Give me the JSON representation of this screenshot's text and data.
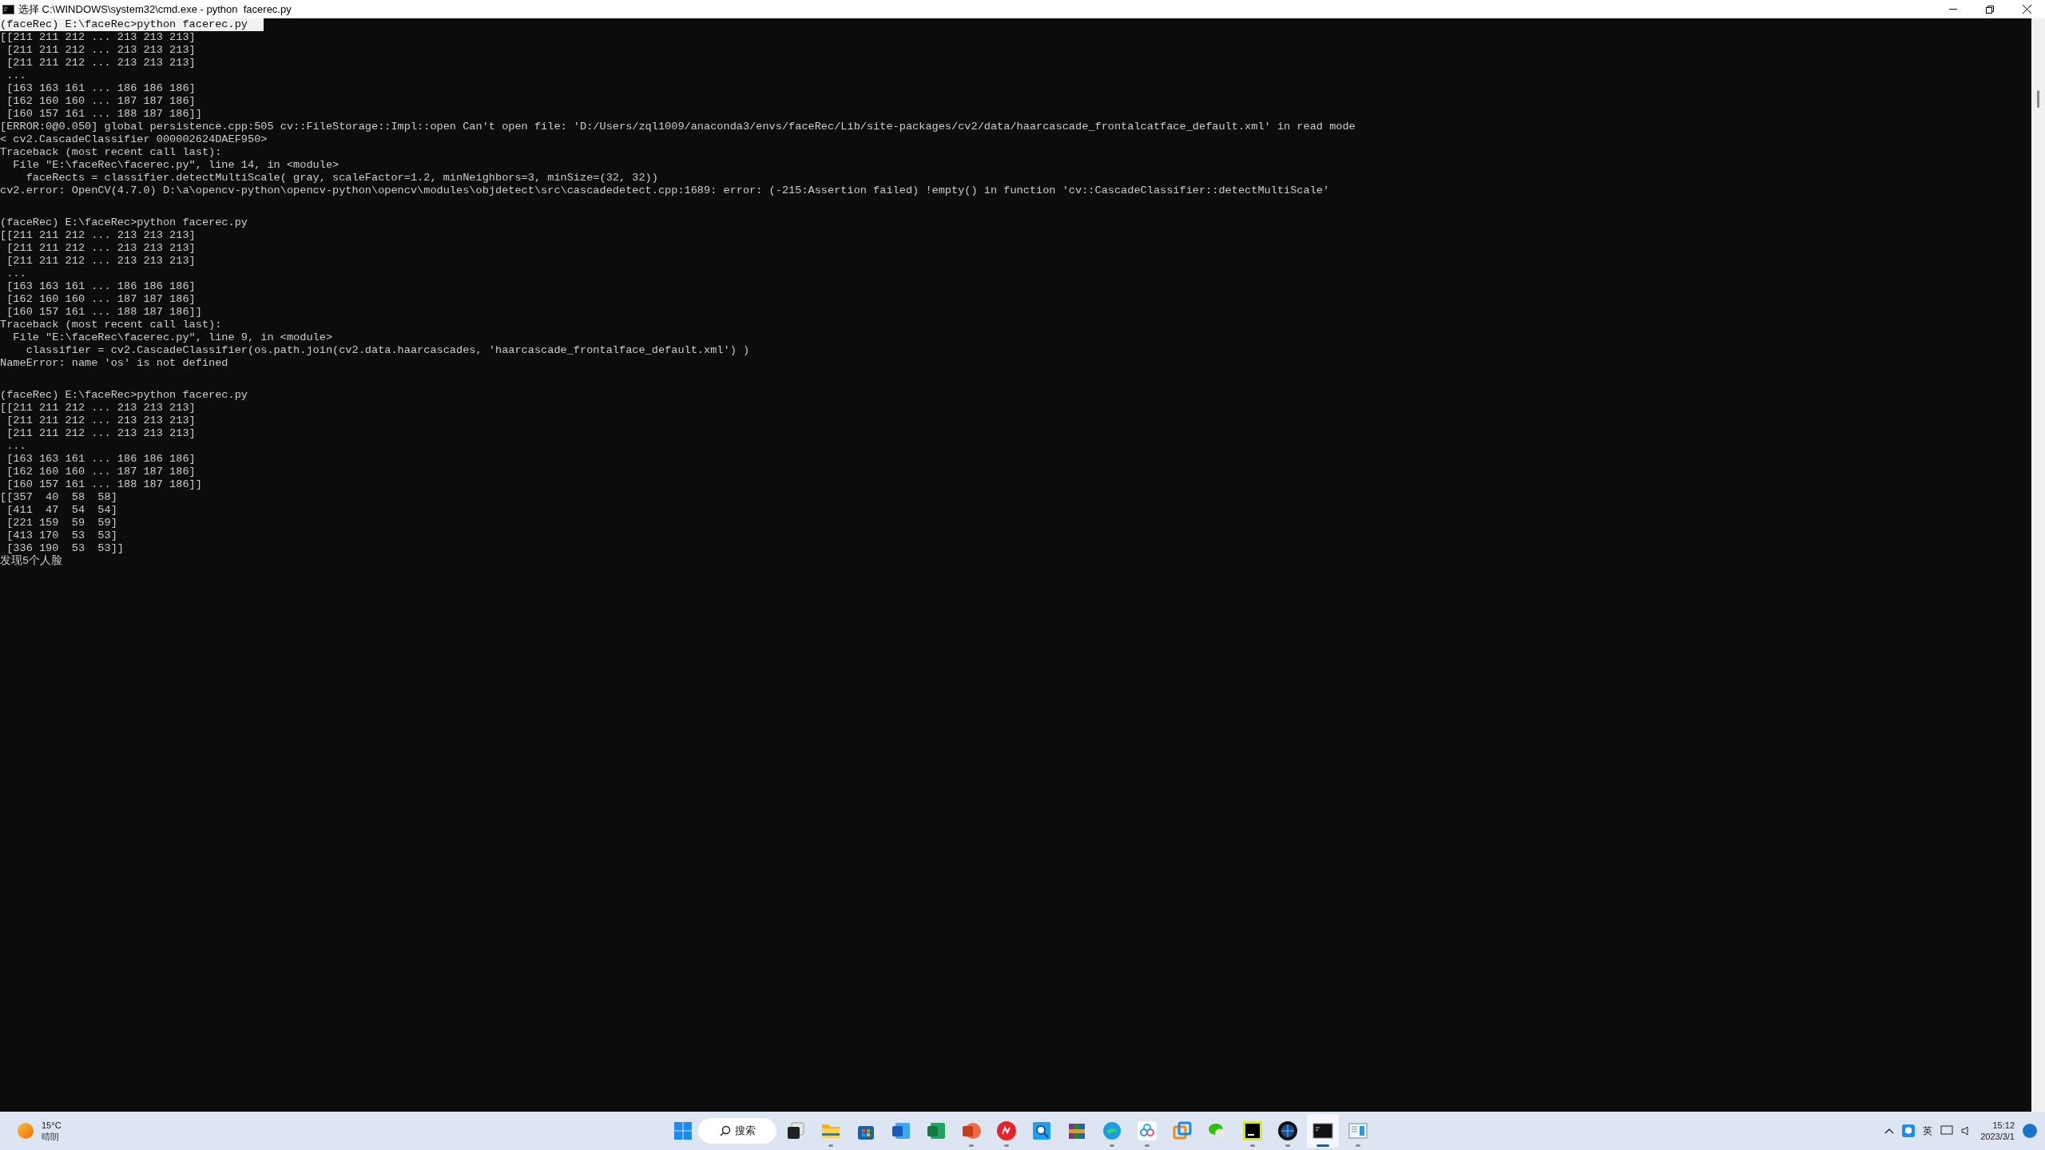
{
  "window": {
    "title": "选择 C:\\WINDOWS\\system32\\cmd.exe - python  facerec.py"
  },
  "terminal": {
    "blocks": [
      {
        "lines": [
          {
            "text": "(faceRec) E:\\faceRec>python facerec.py",
            "selected": true
          },
          {
            "text": "[[211 211 212 ... 213 213 213]",
            "selected": false
          },
          {
            "text": " [211 211 212 ... 213 213 213]",
            "selected": false
          },
          {
            "text": " [211 211 212 ... 213 213 213]",
            "selected": false
          },
          {
            "text": " ...",
            "selected": false
          },
          {
            "text": " [163 163 161 ... 186 186 186]",
            "selected": false
          },
          {
            "text": " [162 160 160 ... 187 187 186]",
            "selected": false
          },
          {
            "text": " [160 157 161 ... 188 187 186]]",
            "selected": false
          },
          {
            "text": "[ERROR:0@0.050] global persistence.cpp:505 cv::FileStorage::Impl::open Can't open file: 'D:/Users/zql1009/anaconda3/envs/faceRec/Lib/site-packages/cv2/data/haarcascade_frontalcatface_default.xml' in read mode",
            "selected": false
          },
          {
            "text": "< cv2.CascadeClassifier 000002624DAEF950>",
            "selected": false
          },
          {
            "text": "Traceback (most recent call last):",
            "selected": false
          },
          {
            "text": "  File \"E:\\faceRec\\facerec.py\", line 14, in <module>",
            "selected": false
          },
          {
            "text": "    faceRects = classifier.detectMultiScale( gray, scaleFactor=1.2, minNeighbors=3, minSize=(32, 32))",
            "selected": false
          },
          {
            "text": "cv2.error: OpenCV(4.7.0) D:\\a\\opencv-python\\opencv-python\\opencv\\modules\\objdetect\\src\\cascadedetect.cpp:1689: error: (-215:Assertion failed) !empty() in function 'cv::CascadeClassifier::detectMultiScale'",
            "selected": false
          }
        ]
      },
      {
        "lines": [
          {
            "text": "(faceRec) E:\\faceRec>python facerec.py",
            "selected": false
          },
          {
            "text": "[[211 211 212 ... 213 213 213]",
            "selected": false
          },
          {
            "text": " [211 211 212 ... 213 213 213]",
            "selected": false
          },
          {
            "text": " [211 211 212 ... 213 213 213]",
            "selected": false
          },
          {
            "text": " ...",
            "selected": false
          },
          {
            "text": " [163 163 161 ... 186 186 186]",
            "selected": false
          },
          {
            "text": " [162 160 160 ... 187 187 186]",
            "selected": false
          },
          {
            "text": " [160 157 161 ... 188 187 186]]",
            "selected": false
          },
          {
            "text": "Traceback (most recent call last):",
            "selected": false
          },
          {
            "text": "  File \"E:\\faceRec\\facerec.py\", line 9, in <module>",
            "selected": false
          },
          {
            "text": "    classifier = cv2.CascadeClassifier(os.path.join(cv2.data.haarcascades, 'haarcascade_frontalface_default.xml') )",
            "selected": false
          },
          {
            "text": "NameError: name 'os' is not defined",
            "selected": false
          }
        ]
      },
      {
        "lines": [
          {
            "text": "(faceRec) E:\\faceRec>python facerec.py",
            "selected": false
          },
          {
            "text": "[[211 211 212 ... 213 213 213]",
            "selected": false
          },
          {
            "text": " [211 211 212 ... 213 213 213]",
            "selected": false
          },
          {
            "text": " [211 211 212 ... 213 213 213]",
            "selected": false
          },
          {
            "text": " ...",
            "selected": false
          },
          {
            "text": " [163 163 161 ... 186 186 186]",
            "selected": false
          },
          {
            "text": " [162 160 160 ... 187 187 186]",
            "selected": false
          },
          {
            "text": " [160 157 161 ... 188 187 186]]",
            "selected": false
          },
          {
            "text": "[[357  40  58  58]",
            "selected": false
          },
          {
            "text": " [411  47  54  54]",
            "selected": false
          },
          {
            "text": " [221 159  59  59]",
            "selected": false
          },
          {
            "text": " [413 170  53  53]",
            "selected": false
          },
          {
            "text": " [336 190  53  53]]",
            "selected": false
          },
          {
            "text": "发现5个人脸",
            "selected": false
          }
        ]
      }
    ]
  },
  "taskbar": {
    "weather": {
      "temperature": "15°C",
      "condition": "晴朗"
    },
    "search": {
      "label": "搜索"
    },
    "apps": [
      {
        "kind": "taskview",
        "running": false,
        "selected": false
      },
      {
        "kind": "folder",
        "running": true,
        "selected": false
      },
      {
        "kind": "store",
        "running": false,
        "selected": false
      },
      {
        "kind": "word",
        "running": false,
        "selected": false
      },
      {
        "kind": "excel",
        "running": false,
        "selected": false
      },
      {
        "kind": "powerpoint",
        "running": true,
        "selected": false
      },
      {
        "kind": "red",
        "running": true,
        "selected": false
      },
      {
        "kind": "magnifier",
        "running": false,
        "selected": false
      },
      {
        "kind": "archive",
        "running": false,
        "selected": false
      },
      {
        "kind": "edge",
        "running": true,
        "selected": false
      },
      {
        "kind": "cloud",
        "running": true,
        "selected": false
      },
      {
        "kind": "squares",
        "running": false,
        "selected": false
      },
      {
        "kind": "chat",
        "running": false,
        "selected": false
      },
      {
        "kind": "pycharm",
        "running": true,
        "selected": false
      },
      {
        "kind": "globe",
        "running": true,
        "selected": false
      },
      {
        "kind": "terminal",
        "running": true,
        "selected": true
      },
      {
        "kind": "panel",
        "running": true,
        "selected": false
      }
    ],
    "tray": {
      "language": "英",
      "time": "15:12",
      "date": "2023/3/1"
    }
  }
}
